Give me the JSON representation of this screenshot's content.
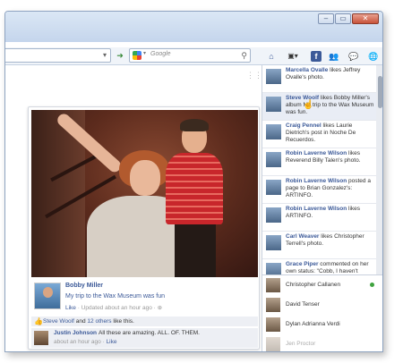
{
  "window": {
    "controls": [
      "–",
      "▭",
      "✕"
    ]
  },
  "navbar": {
    "search_placeholder": "Google",
    "toolbar_icons": [
      "home-icon",
      "dashboard-icon",
      "facebook-icon",
      "friends-icon",
      "messages-icon",
      "globe-icon"
    ]
  },
  "post": {
    "author": "Bobby Miller",
    "album_title": "My trip to the Wax Museum was fun",
    "like_link": "Like",
    "updated": "· Updated about an hour ago ·",
    "likes": {
      "name": "Steve Woolf",
      "and": "and",
      "others": "12 others",
      "suffix": "like this."
    },
    "comment": {
      "author": "Justin Johnson",
      "text": "All these are amazing. ALL. OF. THEM.",
      "time": "about an hour ago ·",
      "like_link": "Like"
    }
  },
  "ticker": [
    {
      "name": "Marcella Ovalle",
      "text": " likes Jeffrey Ovalle's photo."
    },
    {
      "name": "Steve Woolf",
      "text": " likes Bobby Miller's album My trip to the Wax Museum was fun."
    },
    {
      "name": "Craig Pennel",
      "text": " likes Laurie Dietrich's post in Noche De Recuerdos."
    },
    {
      "name": "Robin Laverne Wilson",
      "text": " likes Reverend Billy Talen's photo."
    },
    {
      "name": "Robin Laverne Wilson",
      "text": " posted a page to Brian Gonzalez's: ARTINFO."
    },
    {
      "name": "Robin Laverne Wilson",
      "text": " likes ARTINFO."
    },
    {
      "name": "Carl Weaver",
      "text": " likes Christopher Terrell's photo."
    },
    {
      "name": "Grace Piper",
      "text": " commented on her own status: \"Cobb, I haven't"
    }
  ],
  "chat": [
    {
      "name": "Christopher Callanen",
      "online": true
    },
    {
      "name": "David Tenser",
      "online": false
    },
    {
      "name": "Dylan Adrianna Verdi",
      "online": false
    },
    {
      "name": "Jen Proctor",
      "online": false
    }
  ]
}
